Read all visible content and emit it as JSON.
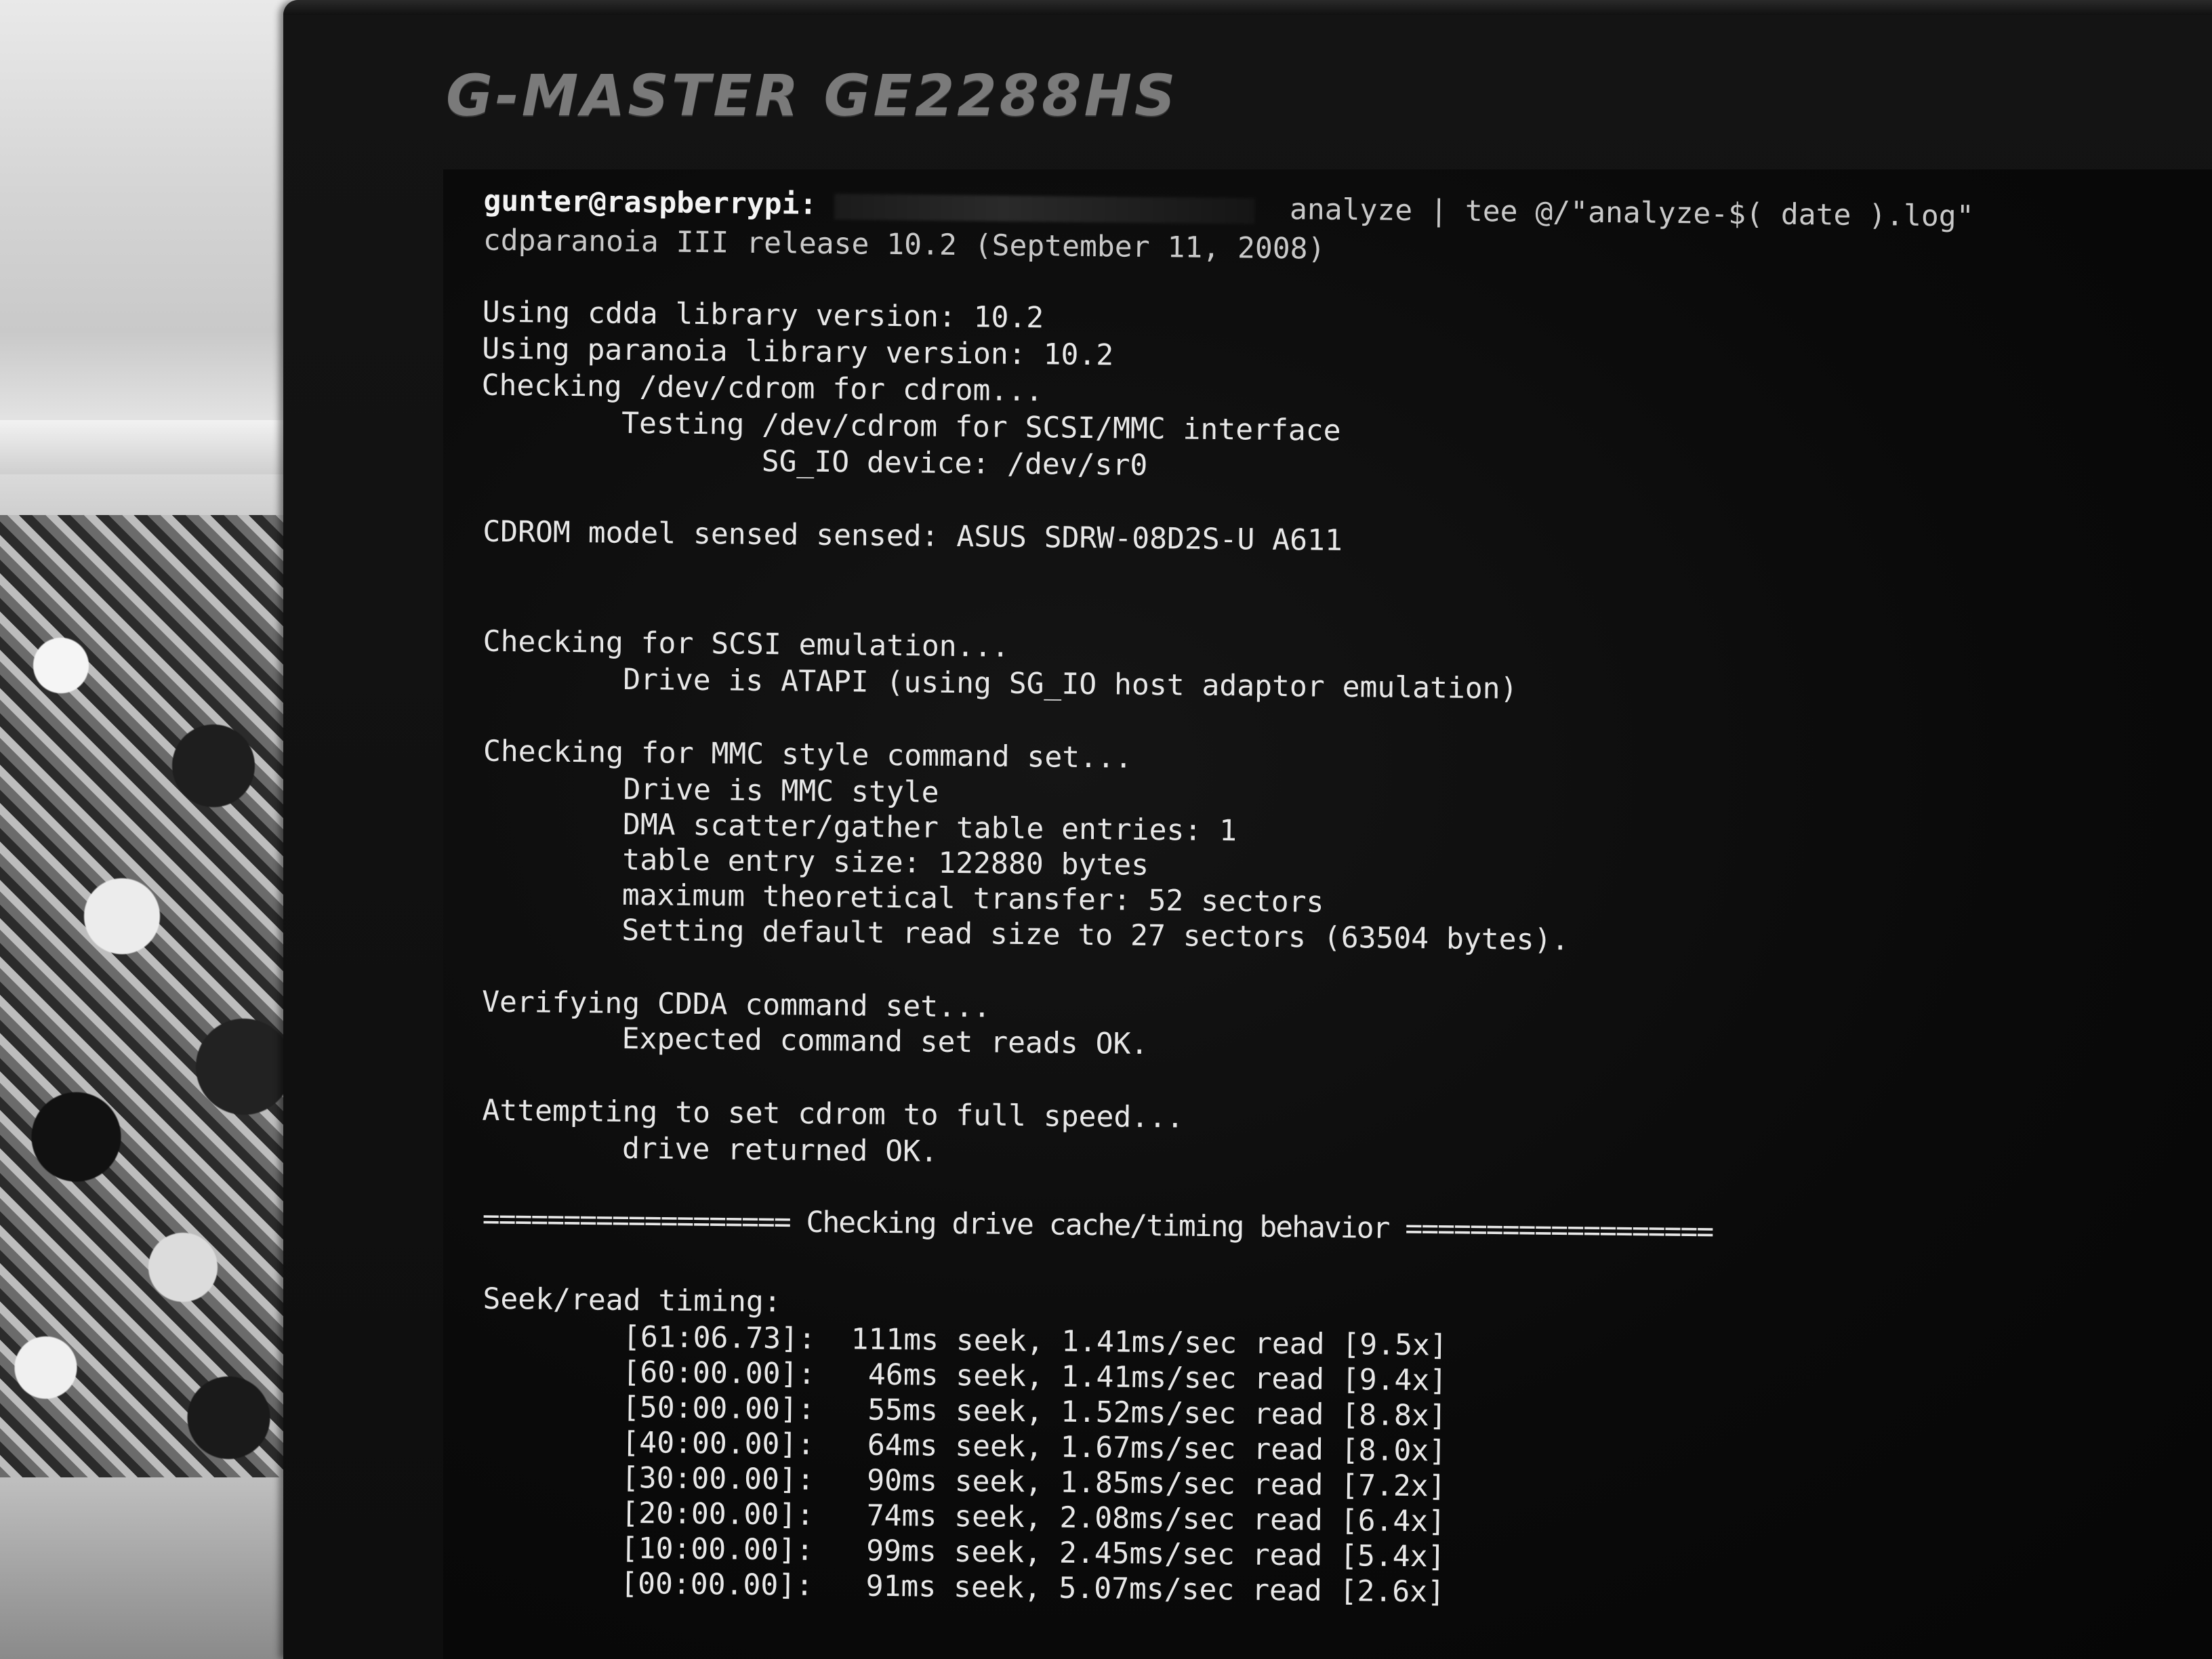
{
  "monitor": {
    "brand": "G-MASTER GE2288HS"
  },
  "terminal": {
    "prompt_user": "gunter@raspberrypi:",
    "prompt_command": "analyze | tee @/\"analyze-$( date ).log\"",
    "lines": {
      "release": "cdparanoia III release 10.2 (September 11, 2008)",
      "cdda_lib": "Using cdda library version: 10.2",
      "paranoia_lib": "Using paranoia library version: 10.2",
      "checking_dev": "Checking /dev/cdrom for cdrom...",
      "testing_scsi": "        Testing /dev/cdrom for SCSI/MMC interface",
      "sg_io": "                SG_IO device: /dev/sr0",
      "model": "CDROM model sensed sensed: ASUS SDRW-08D2S-U A611",
      "checking_scsi_emu": "Checking for SCSI emulation...",
      "drive_atapi": "        Drive is ATAPI (using SG_IO host adaptor emulation)",
      "checking_mmc": "Checking for MMC style command set...",
      "drive_mmc": "        Drive is MMC style",
      "dma_entries": "        DMA scatter/gather table entries: 1",
      "table_entry": "        table entry size: 122880 bytes",
      "max_transfer": "        maximum theoretical transfer: 52 sectors",
      "default_read": "        Setting default read size to 27 sectors (63504 bytes).",
      "verifying": "Verifying CDDA command set...",
      "expected": "        Expected command set reads OK.",
      "attempting": "Attempting to set cdrom to full speed...",
      "drive_ok": "        drive returned OK.",
      "cache_header": "=================== Checking drive cache/timing behavior ===================",
      "seek_header": "Seek/read timing:"
    },
    "seek_rows": [
      "        [61:06.73]:  111ms seek, 1.41ms/sec read [9.5x]",
      "        [60:00.00]:   46ms seek, 1.41ms/sec read [9.4x]",
      "        [50:00.00]:   55ms seek, 1.52ms/sec read [8.8x]",
      "        [40:00.00]:   64ms seek, 1.67ms/sec read [8.0x]",
      "        [30:00.00]:   90ms seek, 1.85ms/sec read [7.2x]",
      "        [20:00.00]:   74ms seek, 2.08ms/sec read [6.4x]",
      "        [10:00.00]:   99ms seek, 2.45ms/sec read [5.4x]",
      "        [00:00.00]:   91ms seek, 5.07ms/sec read [2.6x]"
    ]
  }
}
